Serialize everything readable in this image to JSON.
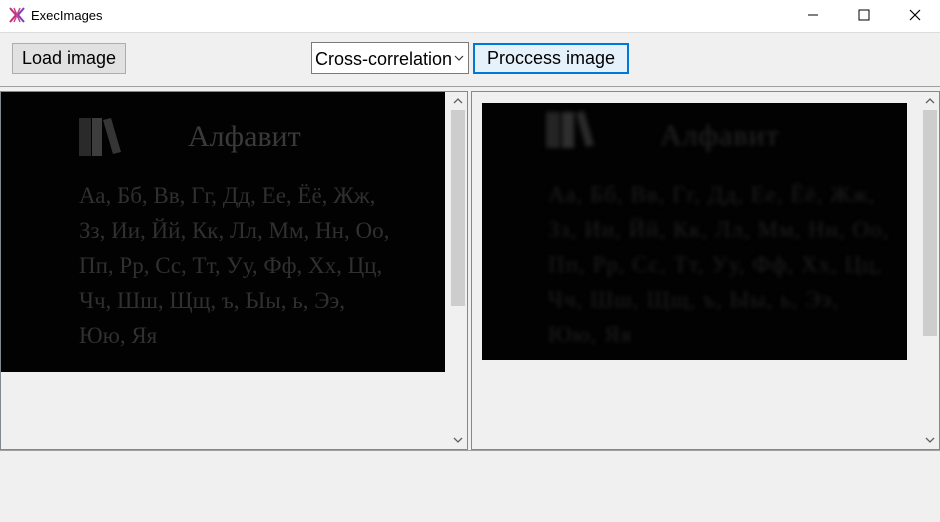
{
  "window": {
    "title": "ExecImages",
    "icon": "app-icon",
    "controls": [
      "minimize-icon",
      "maximize-icon",
      "close-icon"
    ]
  },
  "toolbar": {
    "load_label": "Load image",
    "method_selected": "Cross-correlation",
    "process_label": "Proccess image"
  },
  "source_image": {
    "title": "Алфавит",
    "body": "Аа, Бб, Вв, Гг, Дд, Ее, Ёё, Жж,\nЗз, Ии, Йй, Кк, Лл, Мм, Нн, Оо,\nПп, Рр, Сс, Тт, Уу, Фф, Хх, Цц,\nЧч, Шш, Щщ, ъ, Ыы, ь, Ээ,\nЮю, Яя"
  },
  "result_image": {
    "title": "Алфавит",
    "body": "Аа, Бб, Вв, Гг, Дд, Ее, Ёё, Жж,\nЗз, Ии, Йй, Кк, Лл, Мм, Нн, Оо,\nПп, Рр, Сс, Тт, Уу, Фф, Хх, Цц,\nЧч, Шш, Щщ, ъ, Ыы, ь, Ээ,\nЮю, Яя"
  },
  "colors": {
    "accent": "#0078d7",
    "image_background": "#020202"
  }
}
